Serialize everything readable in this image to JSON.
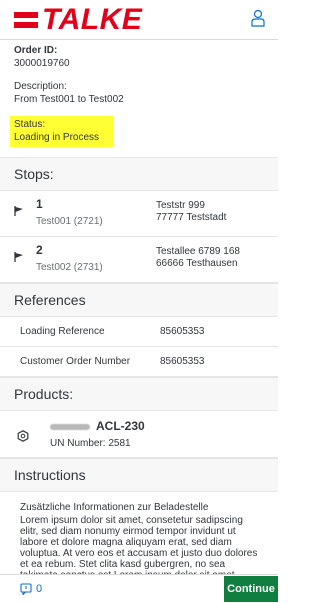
{
  "brand": {
    "name": "TALKE",
    "color": "#e2001a"
  },
  "header": {
    "user_icon": "person-icon"
  },
  "order": {
    "id_label": "Order ID:",
    "id_value": "3000019760",
    "desc_label": "Description:",
    "desc_value": "From Test001 to Test002",
    "status_label": "Status:",
    "status_value": "Loading in Process"
  },
  "stops": {
    "title": "Stops:",
    "items": [
      {
        "num": "1",
        "name": "Test001 (2721)",
        "addr1": "Teststr 999",
        "addr2": "77777 Teststadt"
      },
      {
        "num": "2",
        "name": "Test002 (2731)",
        "addr1": "Testallee 6789 168",
        "addr2": "66666 Testhausen"
      }
    ]
  },
  "references": {
    "title": "References",
    "rows": [
      {
        "key": "Loading Reference",
        "value": "85605353"
      },
      {
        "key": "Customer Order Number",
        "value": "85605353"
      }
    ]
  },
  "products": {
    "title": "Products:",
    "items": [
      {
        "code": "ACL-230",
        "un": "UN Number: 2581"
      }
    ]
  },
  "instructions": {
    "title": "Instructions",
    "heading": "Zusätzliche Informationen zur Beladestelle",
    "body": "Lorem ipsum dolor sit amet, consetetur sadipscing elitr, sed diam nonumy eirmod tempor invidunt ut labore et dolore magna aliquyam erat, sed diam voluptua. At vero eos et accusam et justo duo dolores et ea rebum. Stet clita kasd gubergren, no sea takimata sanctus est Lorem ipsum dolor sit amet. Lorem ipsum dolor sit amet, consetetur sadipscing elitr, sed diam nonumy eirmod"
  },
  "footer": {
    "message_count": "0",
    "continue_label": "Continue",
    "continue_color": "#107e3e"
  }
}
